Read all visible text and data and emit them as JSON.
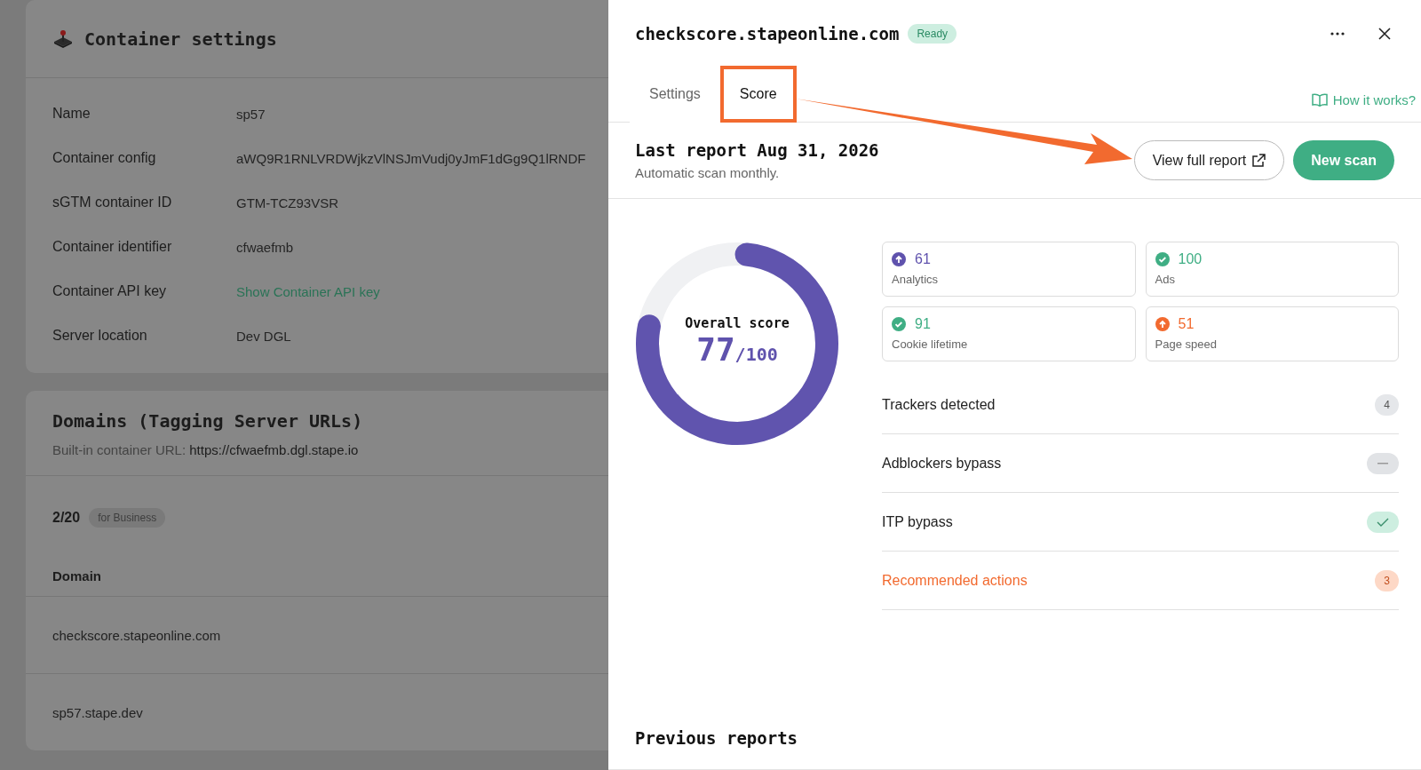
{
  "background": {
    "settings_card": {
      "title": "Container settings",
      "rows": [
        {
          "label": "Name",
          "value": "sp57",
          "kind": "text"
        },
        {
          "label": "Container config",
          "value": "aWQ9R1RNLVRDWjkzVlNSJmVudj0yJmF1dGg9Q1lRNDF",
          "kind": "text"
        },
        {
          "label": "sGTM container ID",
          "value": "GTM-TCZ93VSR",
          "kind": "text"
        },
        {
          "label": "Container identifier",
          "value": "cfwaefmb",
          "kind": "text"
        },
        {
          "label": "Container API key",
          "value": "Show Container API key",
          "kind": "link"
        },
        {
          "label": "Server location",
          "value": "Dev DGL",
          "kind": "text"
        }
      ]
    },
    "domains_card": {
      "title": "Domains (Tagging Server URLs)",
      "url_label": "Built-in container URL:",
      "url": "https://cfwaefmb.dgl.stape.io",
      "count": "2/20",
      "plan_badge": "for Business",
      "column": "Domain",
      "rows": [
        "checkscore.stapeonline.com",
        "sp57.stape.dev"
      ]
    }
  },
  "drawer": {
    "title": "checkscore.stapeonline.com",
    "status": "Ready",
    "tabs": [
      {
        "label": "Settings",
        "selected": false,
        "highlighted": false
      },
      {
        "label": "Score",
        "selected": true,
        "highlighted": true
      }
    ],
    "help_link": "How it works?",
    "report": {
      "title": "Last report Aug 31, 2026",
      "subtitle": "Automatic scan monthly.",
      "buttons": [
        {
          "label": "View full report",
          "kind": "outline"
        },
        {
          "label": "New scan",
          "kind": "primary"
        }
      ]
    },
    "score": {
      "label": "Overall score",
      "value": "77",
      "max": "/100",
      "level": 0.77
    },
    "categories": [
      {
        "value": "61",
        "label": "Analytics",
        "kind": "up",
        "color": "#5f52ad"
      },
      {
        "value": "100",
        "label": "Ads",
        "kind": "check",
        "color": "#3fae84"
      },
      {
        "value": "91",
        "label": "Cookie lifetime",
        "kind": "check",
        "color": "#3fae84"
      },
      {
        "value": "51",
        "label": "Page speed",
        "kind": "up",
        "color": "#f26a2f"
      }
    ],
    "checks": [
      {
        "label": "Trackers detected",
        "kind": "count",
        "count": "4",
        "warning": false
      },
      {
        "label": "Adblockers bypass",
        "kind": "dash",
        "warning": false
      },
      {
        "label": "ITP bypass",
        "kind": "check",
        "warning": false
      },
      {
        "label": "Recommended actions",
        "kind": "count",
        "count": "3",
        "warning": true
      }
    ],
    "previous_title": "Previous reports"
  }
}
